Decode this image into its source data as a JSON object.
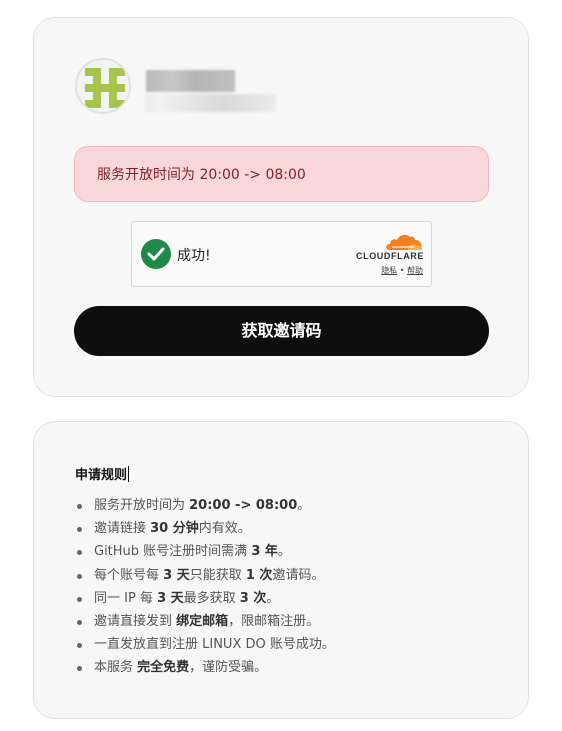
{
  "notice": {
    "text": "服务开放时间为 20:00 -> 08:00"
  },
  "captcha": {
    "status_text": "成功!",
    "brand": "CLOUDFLARE",
    "privacy_link": "隐私",
    "separator": "•",
    "help_link": "帮助"
  },
  "main_button": {
    "label": "获取邀请码"
  },
  "rules": {
    "title": "申请规则",
    "items": [
      [
        {
          "t": "服务开放时间为 "
        },
        {
          "t": "20:00 -> 08:00",
          "b": true
        },
        {
          "t": "。"
        }
      ],
      [
        {
          "t": "邀请链接 "
        },
        {
          "t": "30 分钟",
          "b": true
        },
        {
          "t": "内有效。"
        }
      ],
      [
        {
          "t": "GitHub 账号注册时间需满 "
        },
        {
          "t": "3 年",
          "b": true
        },
        {
          "t": "。"
        }
      ],
      [
        {
          "t": "每个账号每 "
        },
        {
          "t": "3 天",
          "b": true
        },
        {
          "t": "只能获取 "
        },
        {
          "t": "1 次",
          "b": true
        },
        {
          "t": "邀请码。"
        }
      ],
      [
        {
          "t": "同一 IP 每 "
        },
        {
          "t": "3 天",
          "b": true
        },
        {
          "t": "最多获取 "
        },
        {
          "t": "3 次",
          "b": true
        },
        {
          "t": "。"
        }
      ],
      [
        {
          "t": "邀请直接发到 "
        },
        {
          "t": "绑定邮箱",
          "b": true
        },
        {
          "t": "，限邮箱注册。"
        }
      ],
      [
        {
          "t": "一直发放直到注册 LINUX DO 账号成功。"
        }
      ],
      [
        {
          "t": "本服务 "
        },
        {
          "t": "完全免费",
          "b": true
        },
        {
          "t": "，谨防受骗。"
        }
      ]
    ]
  },
  "colors": {
    "notice_bg": "#f8d7da",
    "notice_text": "#842029",
    "button_bg": "#0e0e0e",
    "success_green": "#1f8a47",
    "cloudflare_orange": "#f38020",
    "avatar_green": "#a8c34a"
  },
  "icons": {
    "avatar": "identicon-avatar",
    "check": "check-circle-icon",
    "cloudflare": "cloudflare-cloud-icon"
  }
}
